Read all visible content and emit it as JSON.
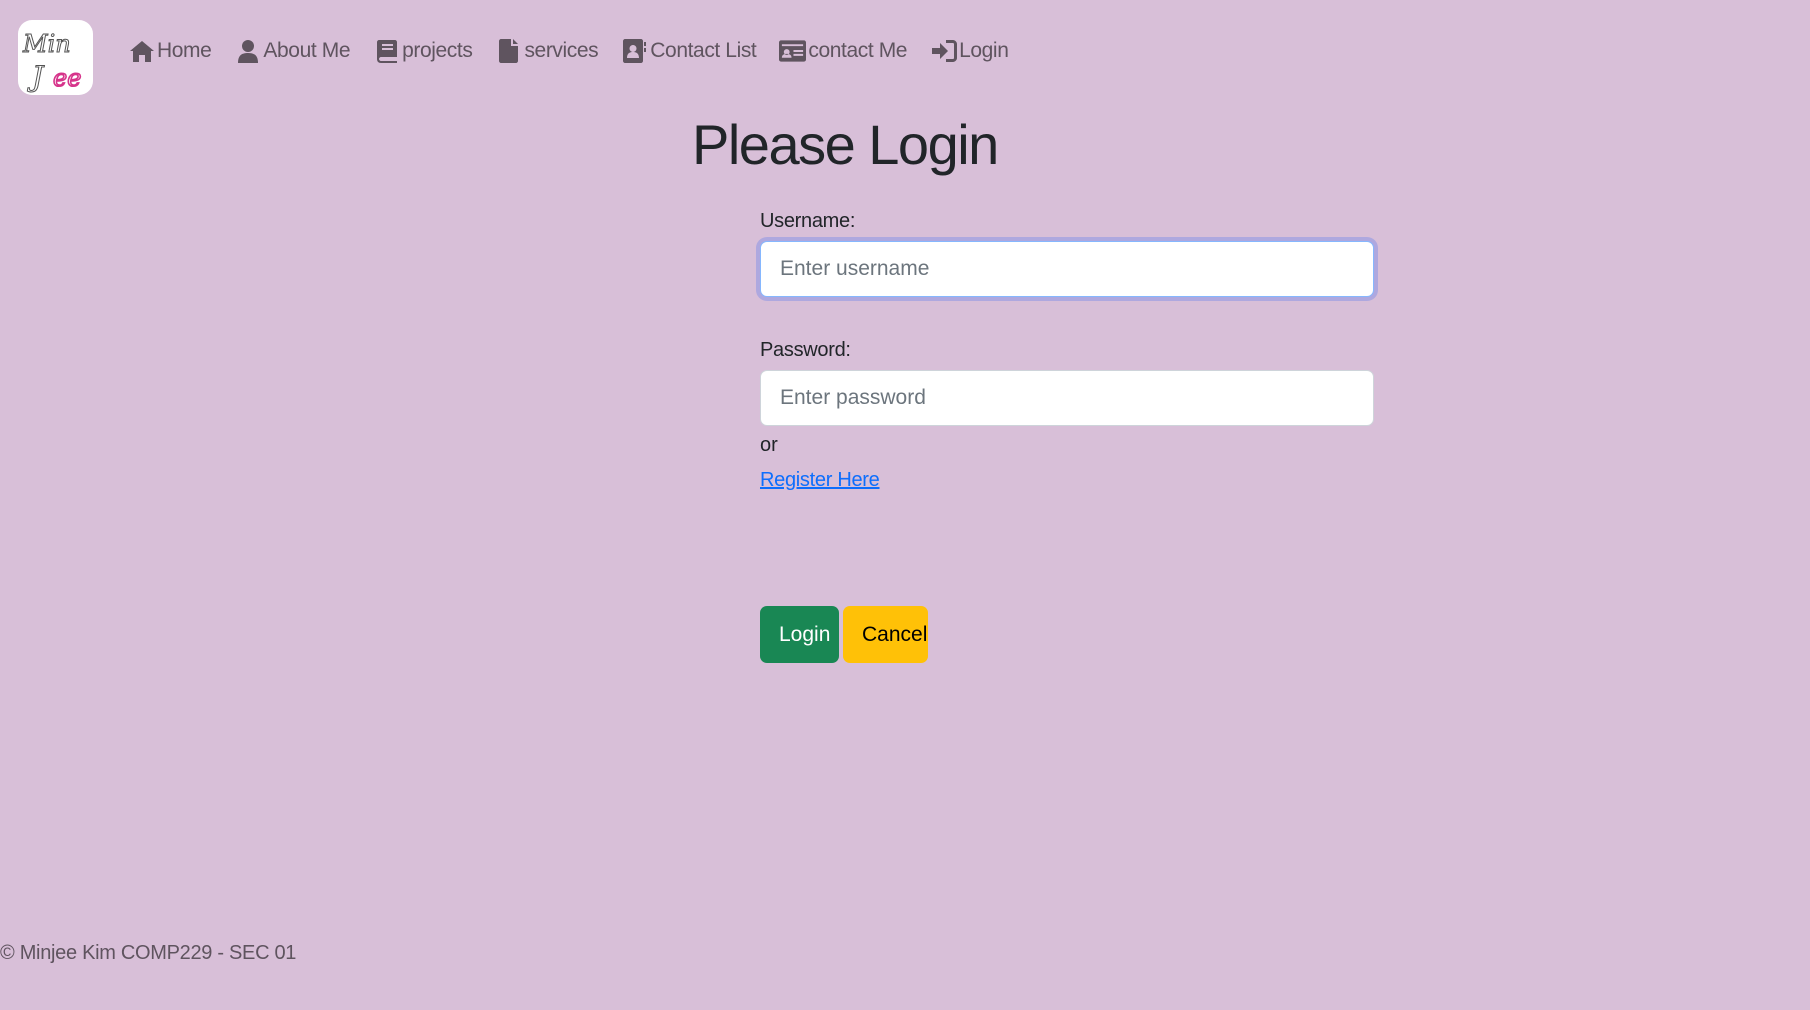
{
  "logo": {
    "line1": "Min",
    "line2": "Jee"
  },
  "nav": {
    "items": [
      {
        "label": "Home",
        "icon": "home-icon"
      },
      {
        "label": "About Me",
        "icon": "user-icon"
      },
      {
        "label": "projects",
        "icon": "book-icon"
      },
      {
        "label": "services",
        "icon": "file-icon"
      },
      {
        "label": "Contact List",
        "icon": "address-book-icon"
      },
      {
        "label": "contact Me",
        "icon": "id-card-icon"
      },
      {
        "label": "Login",
        "icon": "sign-in-icon"
      }
    ]
  },
  "main": {
    "title": "Please Login",
    "username": {
      "label": "Username:",
      "placeholder": "Enter username",
      "value": ""
    },
    "password": {
      "label": "Password:",
      "placeholder": "Enter password",
      "value": ""
    },
    "or_text": "or",
    "register_link": "Register Here",
    "login_button": "Login",
    "cancel_button": "Cancel"
  },
  "footer": {
    "text": "© Minjee Kim COMP229 - SEC 01"
  },
  "colors": {
    "background": "#d8bfd8",
    "nav_text": "#5f545f",
    "login_button": "#198754",
    "cancel_button": "#ffc107",
    "link": "#0d6efd",
    "logo_accent": "#d6338a"
  }
}
